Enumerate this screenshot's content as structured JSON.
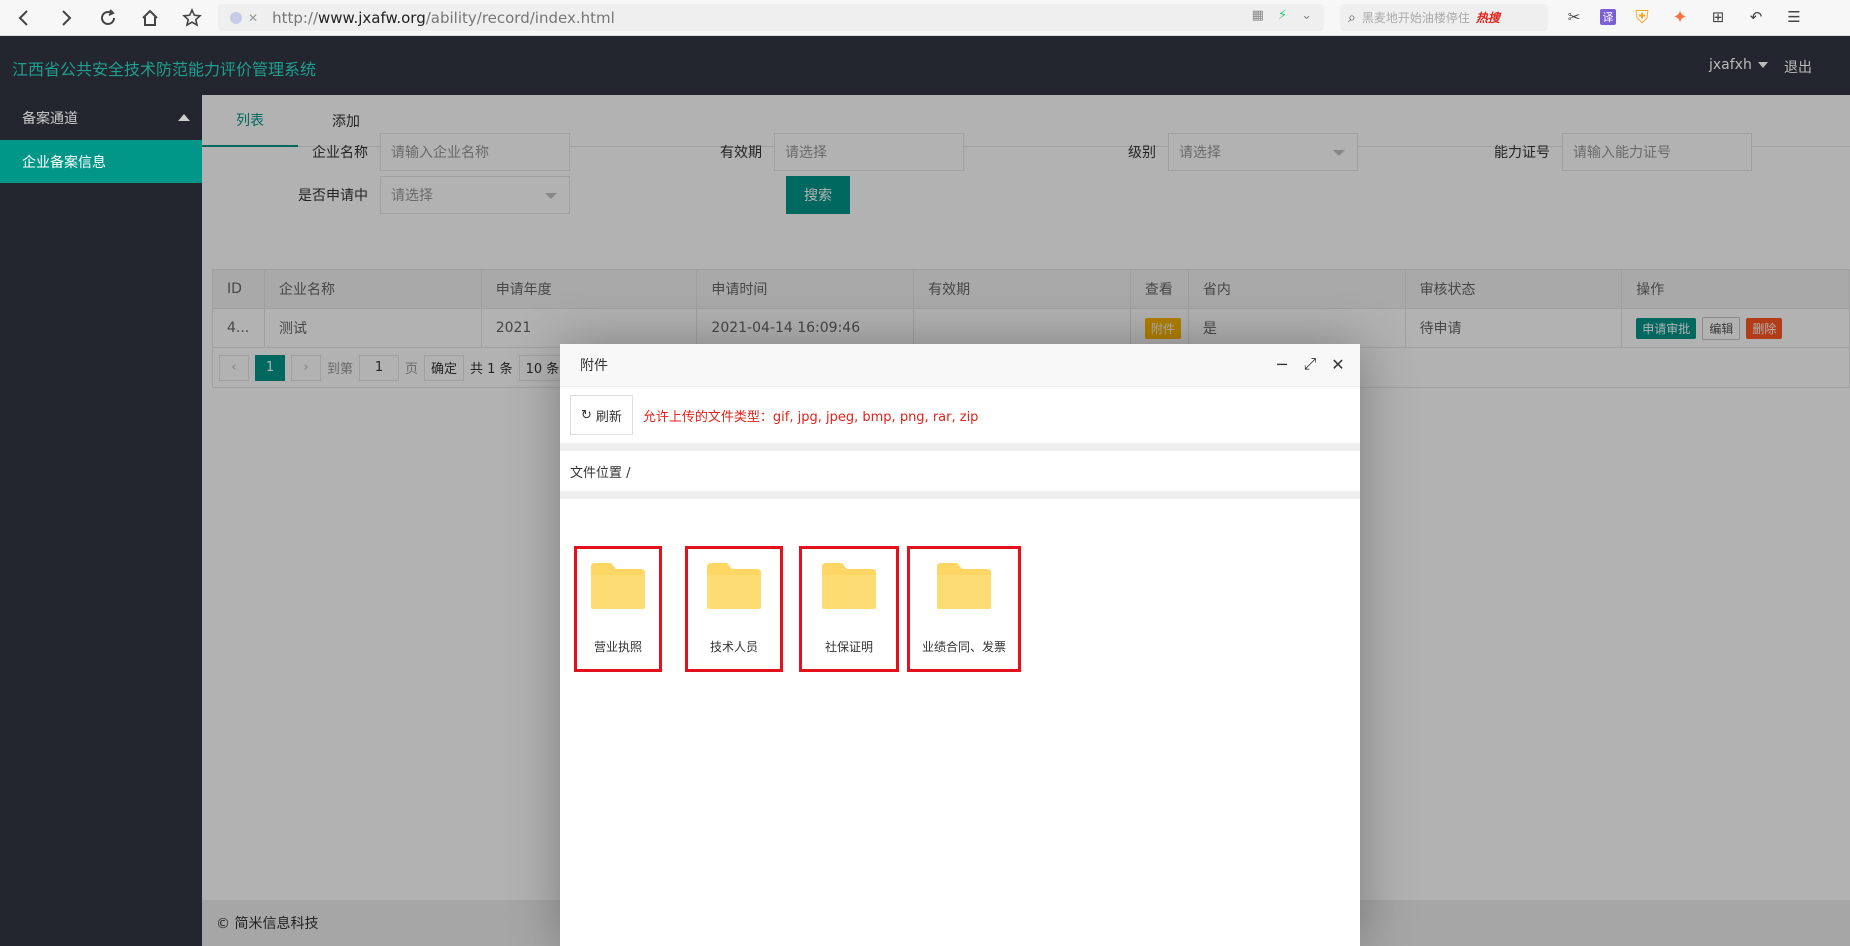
{
  "browser": {
    "url_host": "www.jxafw.org",
    "url_prefix": "http://",
    "url_path": "/ability/record/index.html",
    "search_placeholder": "黑麦地开始油楼停住",
    "search_hot": "热搜",
    "ext_translate": "译"
  },
  "app": {
    "title": "江西省公共安全技术防范能力评价管理系统",
    "user": "jxafxh",
    "logout": "退出"
  },
  "sidebar": {
    "group_label": "备案通道",
    "items": [
      {
        "label": "企业备案信息"
      }
    ]
  },
  "tabs": [
    {
      "label": "列表"
    },
    {
      "label": "添加"
    }
  ],
  "filters": {
    "company_label": "企业名称",
    "company_placeholder": "请输入企业名称",
    "validity_label": "有效期",
    "validity_placeholder": "请选择",
    "level_label": "级别",
    "level_placeholder": "请选择",
    "cert_label": "能力证号",
    "cert_placeholder": "请输入能力证号",
    "applying_label": "是否申请中",
    "applying_placeholder": "请选择",
    "search_button": "搜索"
  },
  "table": {
    "headers": [
      "ID",
      "企业名称",
      "申请年度",
      "申请时间",
      "有效期",
      "查看",
      "省内",
      "审核状态",
      "操作"
    ],
    "rows": [
      {
        "id": "4...",
        "company": "测试",
        "year": "2021",
        "time": "2021-04-14 16:09:46",
        "validity": "",
        "view": "附件",
        "province": "是",
        "status": "待申请",
        "action_apply": "申请审批",
        "action_edit": "编辑",
        "action_delete": "删除"
      }
    ]
  },
  "pager": {
    "current": "1",
    "goto_label": "到第",
    "goto_value": "1",
    "page_unit": "页",
    "confirm": "确定",
    "total": "共 1 条",
    "per_page": "10 条"
  },
  "footer": {
    "text": "© 简米信息科技"
  },
  "modal": {
    "title": "附件",
    "refresh": "刷新",
    "allowed_types": "允许上传的文件类型：gif, jpg, jpeg, bmp, png, rar, zip",
    "location": "文件位置 /",
    "folders": [
      {
        "label": "营业执照"
      },
      {
        "label": "技术人员"
      },
      {
        "label": "社保证明"
      },
      {
        "label": "业绩合同、发票"
      }
    ],
    "folder_color": "#fdd663",
    "highlight_color": "#e3111b"
  }
}
